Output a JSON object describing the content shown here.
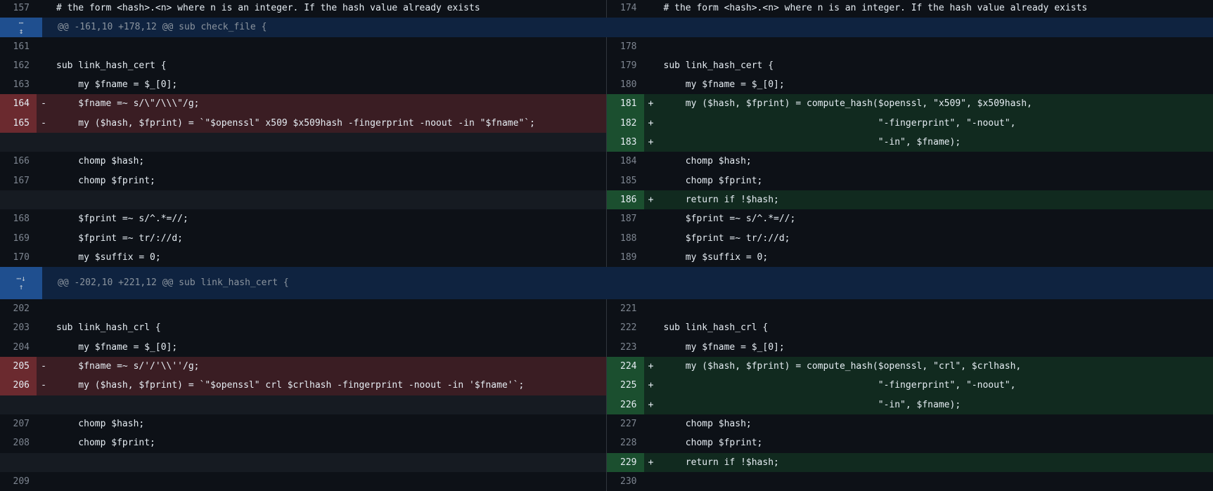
{
  "hunks": {
    "h1": "@@ -161,10 +178,12 @@ sub check_file {",
    "h2": "@@ -202,10 +221,12 @@ sub link_hash_cert {"
  },
  "icons": {
    "expand_both": "expand-icon",
    "expand_down": "arrow-down-icon",
    "expand_up": "arrow-up-icon"
  },
  "colors": {
    "deletion": "#3a1d23",
    "addition": "#112a1f",
    "hunk": "#0f2340"
  },
  "rows": [
    {
      "t": "ctx",
      "l": "157",
      "lc": "# the form <hash>.<n> where n is an integer. If the hash value already exists",
      "r": "174",
      "rc": "# the form <hash>.<n> where n is an integer. If the hash value already exists"
    },
    {
      "t": "hunk1"
    },
    {
      "t": "ctx",
      "l": "161",
      "lc": "",
      "r": "178",
      "rc": ""
    },
    {
      "t": "ctx",
      "l": "162",
      "lc": "sub link_hash_cert {",
      "r": "179",
      "rc": "sub link_hash_cert {"
    },
    {
      "t": "ctx",
      "l": "163",
      "lc": "    my $fname = $_[0];",
      "r": "180",
      "rc": "    my $fname = $_[0];"
    },
    {
      "t": "mod",
      "l": "164",
      "lm": "-",
      "lc": "    $fname =~ s/\\\"/\\\\\\\"/g;",
      "r": "181",
      "rm": "+",
      "rc": "    my ($hash, $fprint) = compute_hash($openssl, \"x509\", $x509hash,"
    },
    {
      "t": "mod",
      "l": "165",
      "lm": "-",
      "lc": "    my ($hash, $fprint) = `\"$openssl\" x509 $x509hash -fingerprint -noout -in \"$fname\"`;",
      "r": "182",
      "rm": "+",
      "rc": "                                       \"-fingerprint\", \"-noout\","
    },
    {
      "t": "addonly",
      "r": "183",
      "rm": "+",
      "rc": "                                       \"-in\", $fname);"
    },
    {
      "t": "ctx",
      "l": "166",
      "lc": "    chomp $hash;",
      "r": "184",
      "rc": "    chomp $hash;"
    },
    {
      "t": "ctx",
      "l": "167",
      "lc": "    chomp $fprint;",
      "r": "185",
      "rc": "    chomp $fprint;"
    },
    {
      "t": "addonly",
      "r": "186",
      "rm": "+",
      "rc": "    return if !$hash;"
    },
    {
      "t": "ctx",
      "l": "168",
      "lc": "    $fprint =~ s/^.*=//;",
      "r": "187",
      "rc": "    $fprint =~ s/^.*=//;"
    },
    {
      "t": "ctx",
      "l": "169",
      "lc": "    $fprint =~ tr/://d;",
      "r": "188",
      "rc": "    $fprint =~ tr/://d;"
    },
    {
      "t": "ctx",
      "l": "170",
      "lc": "    my $suffix = 0;",
      "r": "189",
      "rc": "    my $suffix = 0;"
    },
    {
      "t": "hunk2"
    },
    {
      "t": "ctx",
      "l": "202",
      "lc": "",
      "r": "221",
      "rc": ""
    },
    {
      "t": "ctx",
      "l": "203",
      "lc": "sub link_hash_crl {",
      "r": "222",
      "rc": "sub link_hash_crl {"
    },
    {
      "t": "ctx",
      "l": "204",
      "lc": "    my $fname = $_[0];",
      "r": "223",
      "rc": "    my $fname = $_[0];"
    },
    {
      "t": "mod",
      "l": "205",
      "lm": "-",
      "lc": "    $fname =~ s/'/'\\\\''/g;",
      "r": "224",
      "rm": "+",
      "rc": "    my ($hash, $fprint) = compute_hash($openssl, \"crl\", $crlhash,"
    },
    {
      "t": "mod",
      "l": "206",
      "lm": "-",
      "lc": "    my ($hash, $fprint) = `\"$openssl\" crl $crlhash -fingerprint -noout -in '$fname'`;",
      "r": "225",
      "rm": "+",
      "rc": "                                       \"-fingerprint\", \"-noout\","
    },
    {
      "t": "addonly",
      "r": "226",
      "rm": "+",
      "rc": "                                       \"-in\", $fname);"
    },
    {
      "t": "ctx",
      "l": "207",
      "lc": "    chomp $hash;",
      "r": "227",
      "rc": "    chomp $hash;"
    },
    {
      "t": "ctx",
      "l": "208",
      "lc": "    chomp $fprint;",
      "r": "228",
      "rc": "    chomp $fprint;"
    },
    {
      "t": "addonly",
      "r": "229",
      "rm": "+",
      "rc": "    return if !$hash;"
    },
    {
      "t": "ctx",
      "l": "209",
      "lc": "",
      "r": "230",
      "rc": ""
    }
  ]
}
